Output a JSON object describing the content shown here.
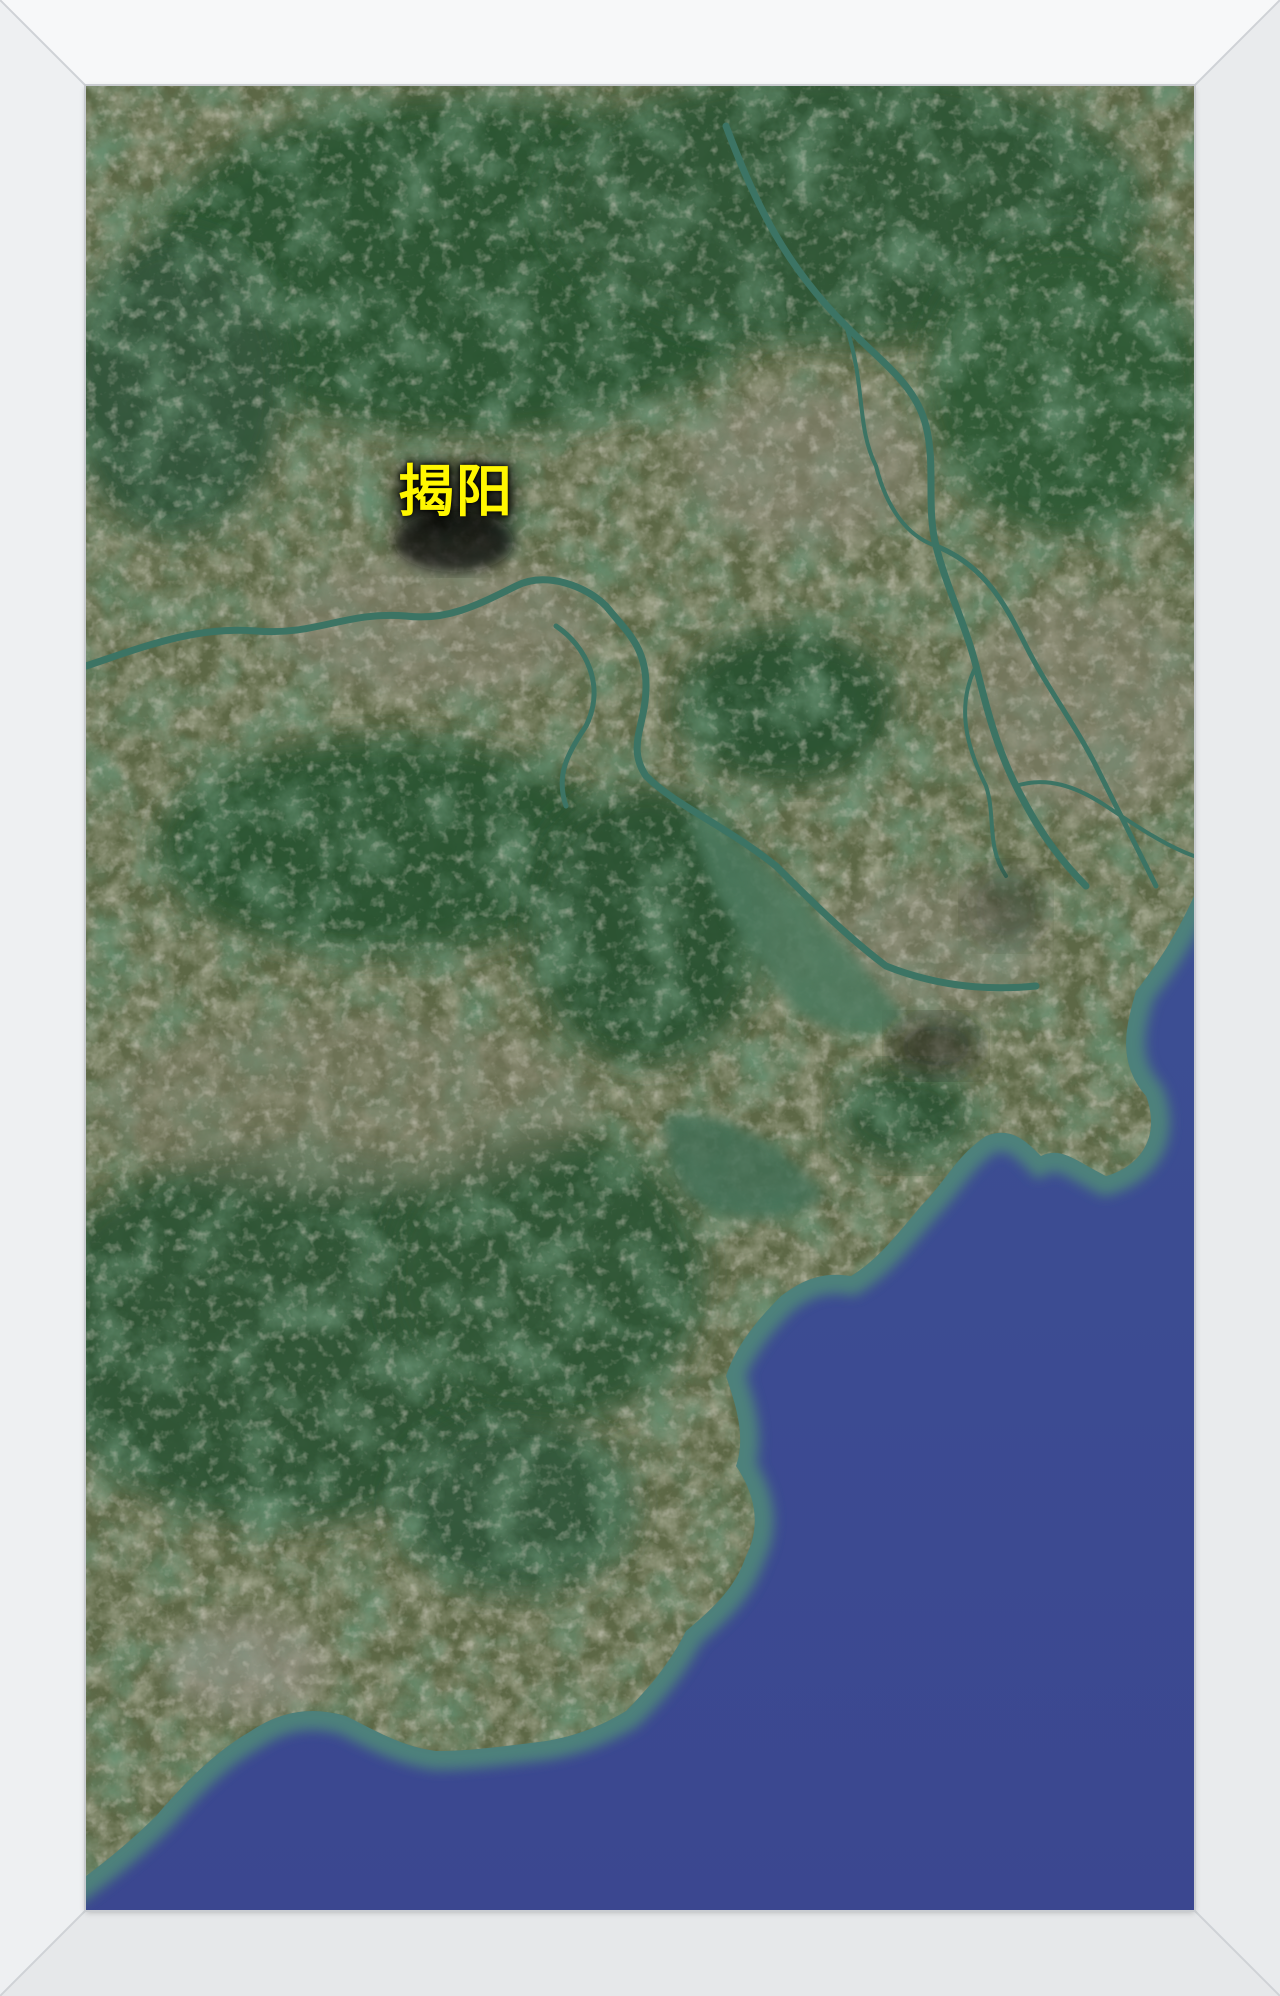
{
  "map": {
    "city_label": "揭阳",
    "colors": {
      "sea": "#3f4f93",
      "sea_coastal": "#4f7f7a",
      "river": "#3f7768",
      "mountain": "#284f2e",
      "farmland": "#6a6e4e",
      "urban": "#8c8776",
      "label_text": "#fff700",
      "frame": "#f2f3f4"
    },
    "icons": [
      "photo-frame"
    ]
  }
}
